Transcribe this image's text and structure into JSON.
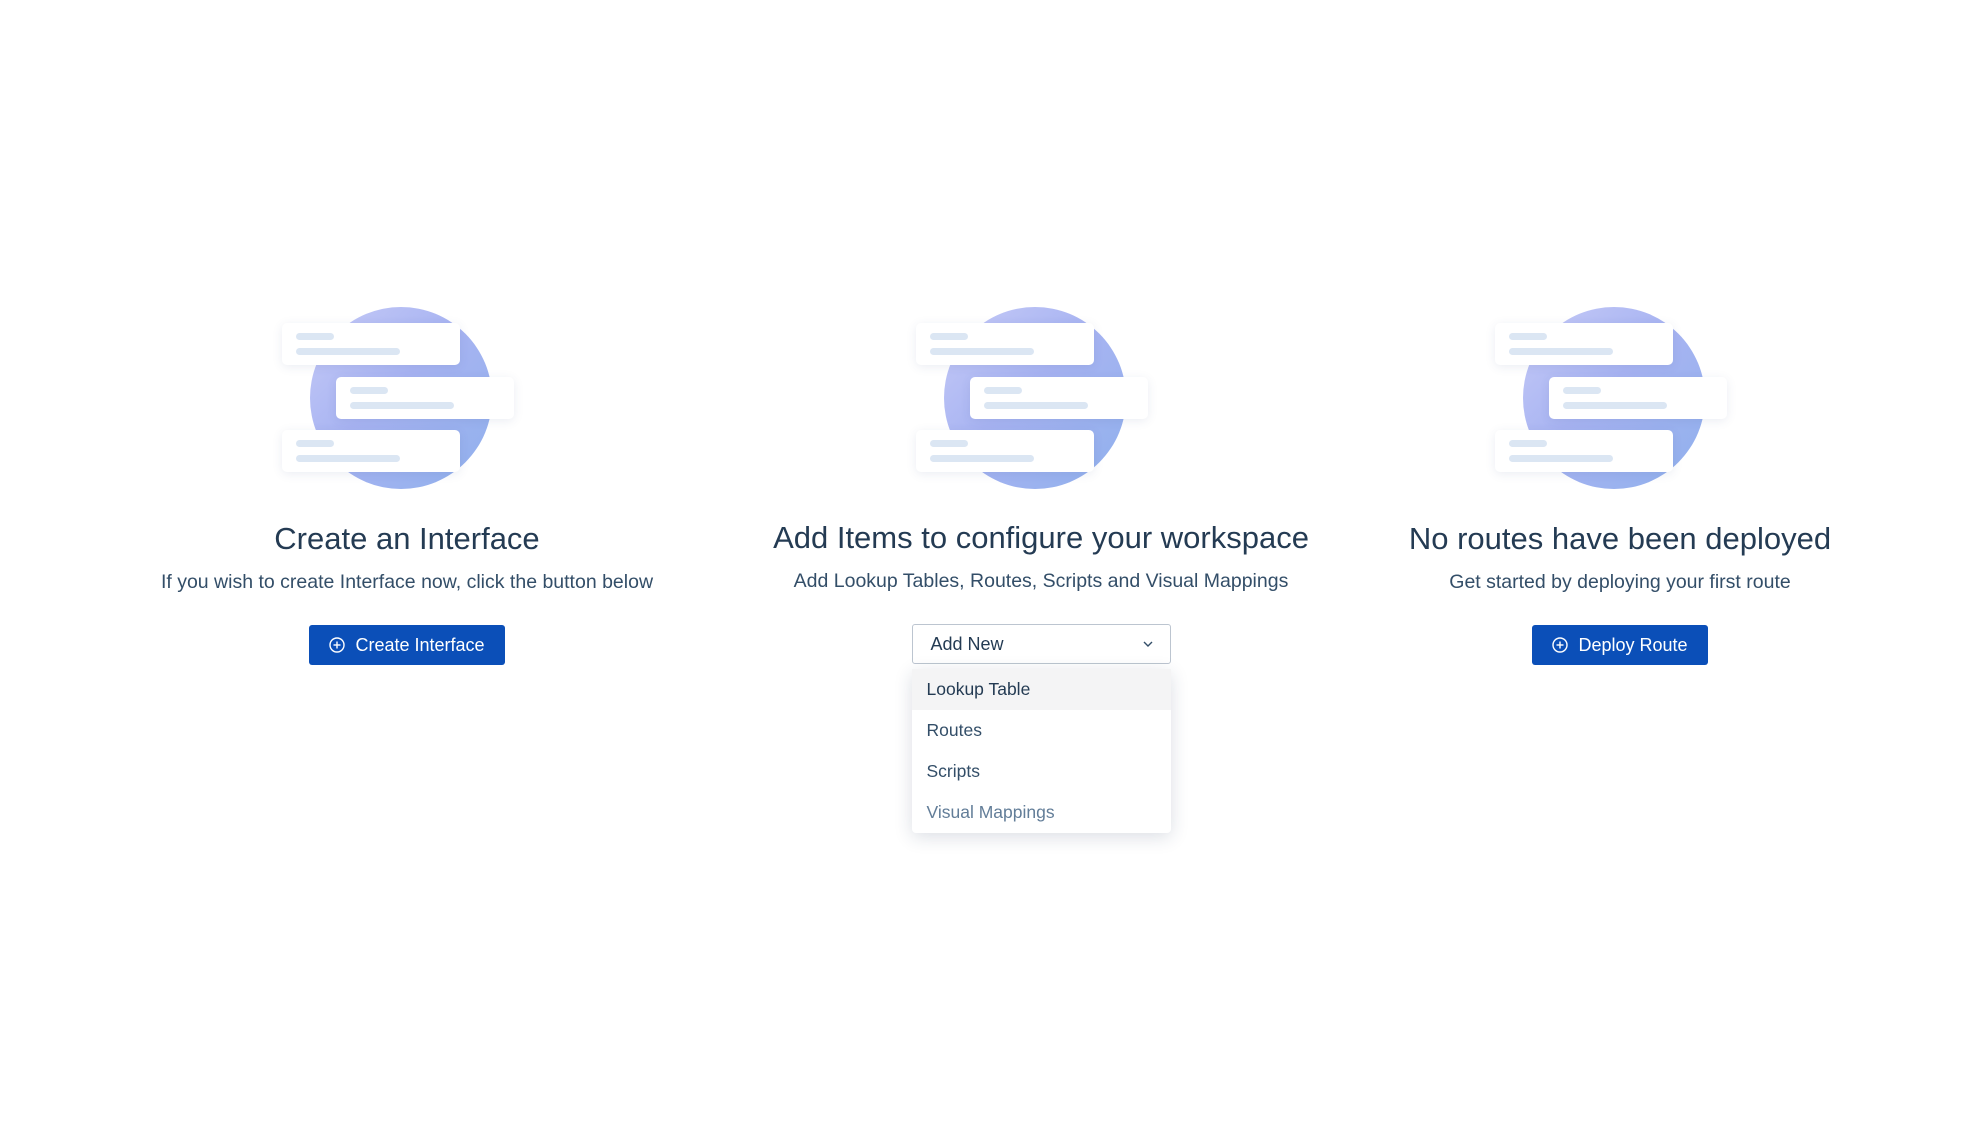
{
  "panels": [
    {
      "title": "Create an Interface",
      "subtitle": "If you wish to create Interface now, click the button below",
      "button_label": "Create Interface"
    },
    {
      "title": "Add Items to configure your workspace",
      "subtitle": "Add Lookup Tables, Routes, Scripts and Visual Mappings",
      "select_value": "Add New",
      "menu_items": [
        "Lookup Table",
        "Routes",
        "Scripts",
        "Visual Mappings"
      ],
      "highlighted_item": "Lookup Table"
    },
    {
      "title": "No routes have been deployed",
      "subtitle": "Get started by deploying your first route",
      "button_label": "Deploy Route"
    }
  ],
  "colors": {
    "primary_button": "#0b4fb8",
    "title_text": "#243b53",
    "illustration_circle": "#a8b4f2"
  },
  "icons": {
    "button_icon": "plus-circle-icon",
    "select_icon": "chevron-down-icon",
    "illustration": "empty-state-list-illustration"
  }
}
